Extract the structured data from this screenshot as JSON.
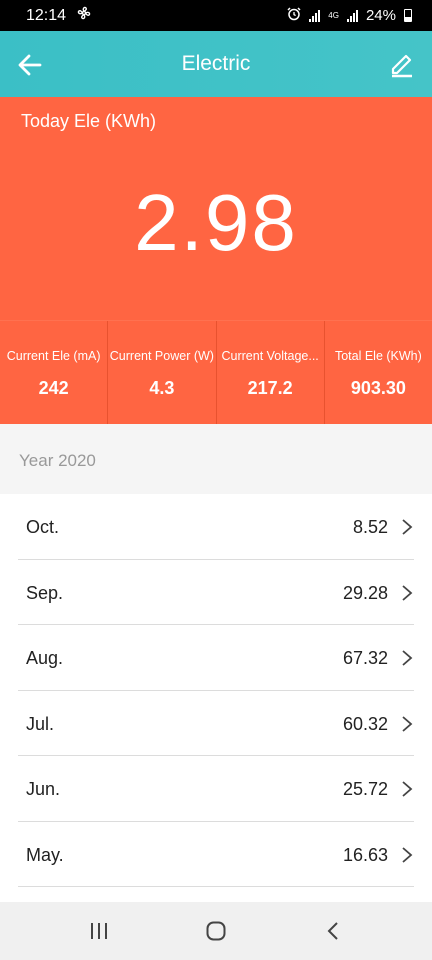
{
  "status_bar": {
    "time": "12:14",
    "battery": "24%",
    "network": "4G",
    "icons": [
      "fan-icon",
      "alarm-icon",
      "signal-icon",
      "battery-icon"
    ]
  },
  "app_bar": {
    "title": "Electric",
    "back_icon": "arrow-left-icon",
    "edit_icon": "pencil-icon"
  },
  "summary": {
    "label": "Today Ele (KWh)",
    "value": "2.98"
  },
  "stats": [
    {
      "label": "Current Ele (mA)",
      "value": "242"
    },
    {
      "label": "Current Power (W)",
      "value": "4.3"
    },
    {
      "label": "Current Voltage...",
      "value": "217.2"
    },
    {
      "label": "Total Ele (KWh)",
      "value": "903.30"
    }
  ],
  "year_label": "Year 2020",
  "months": [
    {
      "name": "Oct.",
      "value": "8.52"
    },
    {
      "name": "Sep.",
      "value": "29.28"
    },
    {
      "name": "Aug.",
      "value": "67.32"
    },
    {
      "name": "Jul.",
      "value": "60.32"
    },
    {
      "name": "Jun.",
      "value": "25.72"
    },
    {
      "name": "May.",
      "value": "16.63"
    }
  ],
  "colors": {
    "header": "#3bbfc6",
    "accent": "#ff6542"
  },
  "nav_bar": {
    "icons": [
      "recent-apps-icon",
      "home-icon",
      "back-icon"
    ]
  }
}
